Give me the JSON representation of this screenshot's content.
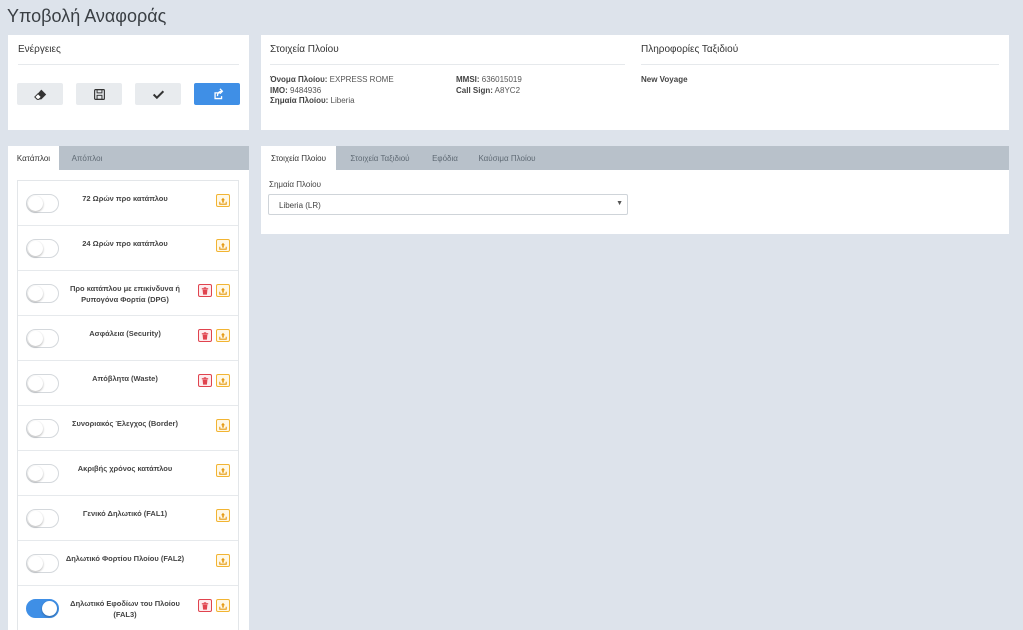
{
  "page": {
    "title": "Υποβολή Αναφοράς"
  },
  "actions": {
    "title": "Ενέργειες",
    "buttons": [
      {
        "name": "eraser-button",
        "icon": "eraser-icon"
      },
      {
        "name": "save-button",
        "icon": "floppy-icon"
      },
      {
        "name": "validate-button",
        "icon": "check-icon"
      },
      {
        "name": "submit-button",
        "icon": "share-icon"
      }
    ]
  },
  "vessel": {
    "title": "Στοιχεία Πλοίου",
    "name_label": "Όνομα Πλοίου:",
    "name_value": " EXPRESS ROME",
    "imo_label": "IMO:",
    "imo_value": " 9484936",
    "flag_label": "Σημαία Πλοίου:",
    "flag_value": " Liberia",
    "mmsi_label": "MMSI:",
    "mmsi_value": " 636015019",
    "callsign_label": "Call Sign:",
    "callsign_value": " A8YC2"
  },
  "voyage": {
    "title": "Πληροφορίες Ταξιδιού",
    "value": "New Voyage"
  },
  "left_tabs": [
    "Κατάπλοι",
    "Απόπλοι"
  ],
  "reports": [
    {
      "label": "72 Ωρών προ κατάπλου",
      "on": false,
      "delete": false
    },
    {
      "label": "24 Ωρών προ κατάπλου",
      "on": false,
      "delete": false
    },
    {
      "label": "Προ κατάπλου με επικίνδυνα ή Ρυπογόνα Φορτία (DPG)",
      "on": false,
      "delete": true
    },
    {
      "label": "Ασφάλεια (Security)",
      "on": false,
      "delete": true
    },
    {
      "label": "Απόβλητα (Waste)",
      "on": false,
      "delete": true
    },
    {
      "label": "Συνοριακός Έλεγχος (Border)",
      "on": false,
      "delete": false
    },
    {
      "label": "Ακριβής χρόνος κατάπλου",
      "on": false,
      "delete": false
    },
    {
      "label": "Γενικό Δηλωτικό (FAL1)",
      "on": false,
      "delete": false
    },
    {
      "label": "Δηλωτικό Φορτίου Πλοίου (FAL2)",
      "on": false,
      "delete": false
    },
    {
      "label": "Δηλωτικό Εφοδίων του Πλοίου (FAL3)",
      "on": true,
      "delete": true
    }
  ],
  "right_tabs": [
    "Στοιχεία Πλοίου",
    "Στοιχεία Ταξιδιού",
    "Εφόδια",
    "Καύσιμα Πλοίου"
  ],
  "form": {
    "flag_label": "Σημαία Πλοίου",
    "flag_selected": "Liberia (LR)"
  },
  "colors": {
    "accent": "#3f8fe6",
    "warning": "#f2b432",
    "danger": "#e0434e"
  }
}
